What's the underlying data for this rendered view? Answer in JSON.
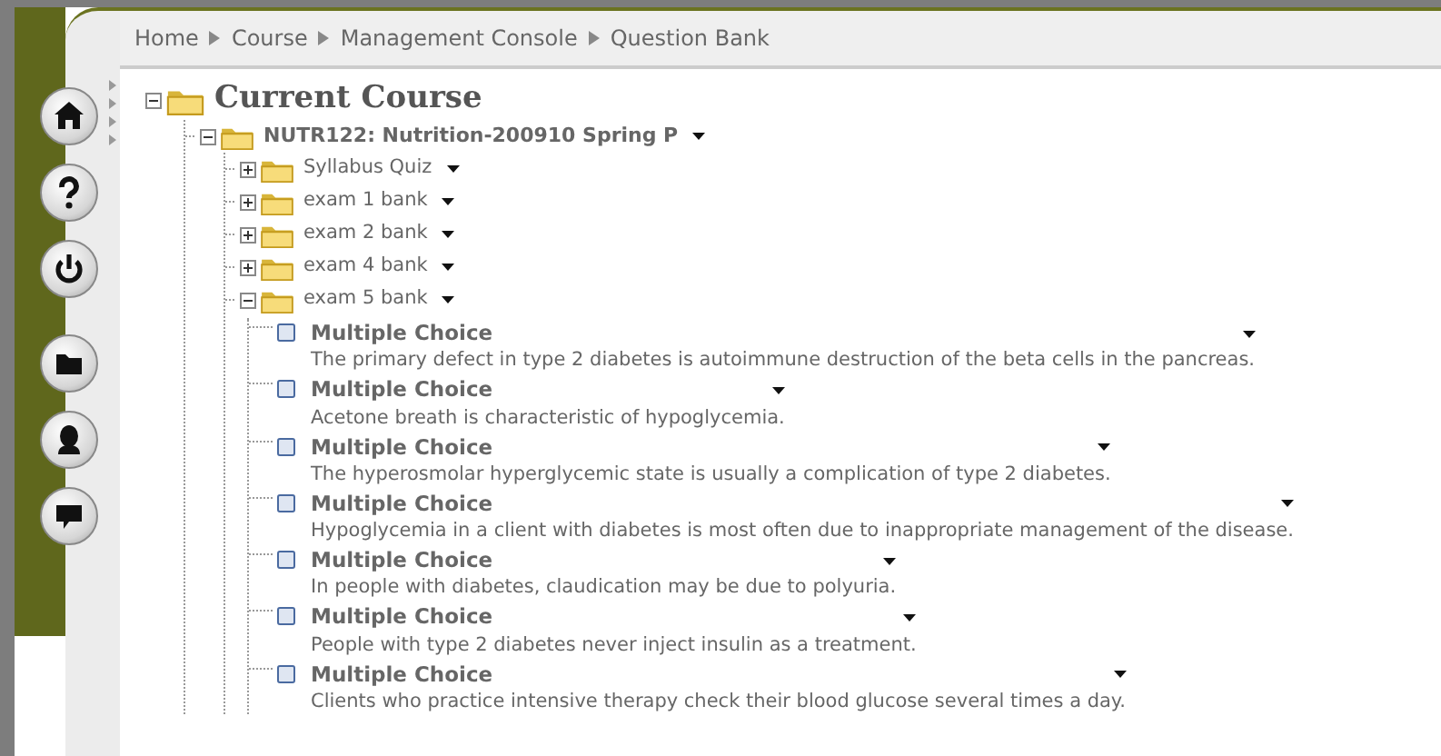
{
  "breadcrumb": [
    "Home",
    "Course",
    "Management Console",
    "Question Bank"
  ],
  "sidebar": {
    "buttons": [
      {
        "kind": "home"
      },
      {
        "kind": "help"
      },
      {
        "kind": "power"
      },
      {
        "kind": "folder"
      },
      {
        "kind": "person"
      },
      {
        "kind": "chat"
      }
    ]
  },
  "tree": {
    "kind": "root",
    "label": "Current Course",
    "expanded": true,
    "children": [
      {
        "kind": "course",
        "label": "NUTR122: Nutrition-200910 Spring P",
        "expanded": true,
        "children": [
          {
            "kind": "folder",
            "label": "Syllabus Quiz",
            "expanded": false
          },
          {
            "kind": "folder",
            "label": "exam 1 bank",
            "expanded": false
          },
          {
            "kind": "folder",
            "label": "exam 2 bank",
            "expanded": false
          },
          {
            "kind": "folder",
            "label": "exam 4 bank",
            "expanded": false
          },
          {
            "kind": "folder",
            "label": "exam 5 bank",
            "expanded": true,
            "children": [
              {
                "kind": "question",
                "label": "Multiple Choice",
                "text": "The primary defect in type 2 diabetes is autoimmune destruction of the beta cells in the pancreas."
              },
              {
                "kind": "question",
                "label": "Multiple Choice",
                "text": "Acetone breath is characteristic of hypoglycemia."
              },
              {
                "kind": "question",
                "label": "Multiple Choice",
                "text": "The hyperosmolar hyperglycemic state is usually a complication of type 2 diabetes."
              },
              {
                "kind": "question",
                "label": "Multiple Choice",
                "text": "Hypoglycemia in a client with diabetes is most often due to inappropriate management of the disease."
              },
              {
                "kind": "question",
                "label": "Multiple Choice",
                "text": "In people with diabetes, claudication may be due to polyuria."
              },
              {
                "kind": "question",
                "label": "Multiple Choice",
                "text": "People with type 2 diabetes never inject insulin as a treatment."
              },
              {
                "kind": "question",
                "label": "Multiple Choice",
                "text": "Clients who practice intensive therapy check their blood glucose several times a day."
              }
            ]
          }
        ]
      }
    ]
  }
}
